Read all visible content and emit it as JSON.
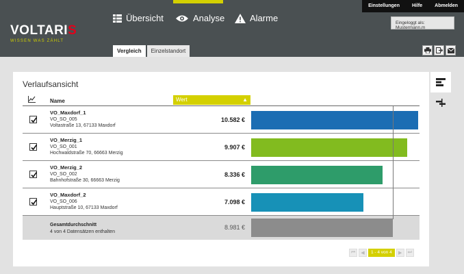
{
  "brand": {
    "name_main": "VOLTARI",
    "name_accent": "S",
    "tagline": "WISSEN WAS ZÄHLT"
  },
  "nav": [
    {
      "label": "Übersicht",
      "icon": "list-icon"
    },
    {
      "label": "Analyse",
      "icon": "eye-icon"
    },
    {
      "label": "Alarme",
      "icon": "warning-icon"
    }
  ],
  "top_links": [
    "Einstellungen",
    "Hilfe",
    "Abmelden"
  ],
  "logged_in": "Eingeloggt als: Mustermann.m",
  "subtabs": [
    {
      "label": "Vergleich",
      "active": true
    },
    {
      "label": "Einzelstandort",
      "active": false
    }
  ],
  "header_actions": [
    "print-icon",
    "export-icon",
    "mail-icon"
  ],
  "panel": {
    "title": "Verlaufsansicht",
    "columns": {
      "name": "Name",
      "value": "Wert"
    }
  },
  "side_tools": [
    "bar-view-icon",
    "split-view-icon"
  ],
  "rows": [
    {
      "name": "VO_Maxdorf_1",
      "code": "VO_SO_005",
      "address": "Voltastraße 13, 67133 Maxdorf",
      "value_label": "10.582 €",
      "value": 10582,
      "color": "#1b6db3",
      "checked": true
    },
    {
      "name": "VO_Merzig_1",
      "code": "VO_SO_001",
      "address": "Hochwaldstraße 70, 66663 Merzig",
      "value_label": "9.907 €",
      "value": 9907,
      "color": "#82bb1f",
      "checked": true
    },
    {
      "name": "VO_Merzig_2",
      "code": "VO_SO_002",
      "address": "Bahnhofstraße 30, 66663 Merzig",
      "value_label": "8.336 €",
      "value": 8336,
      "color": "#2e9c6a",
      "checked": true
    },
    {
      "name": "VO_Maxdorf_2",
      "code": "VO_SO_006",
      "address": "Hauptstraße 10, 67133 Maxdorf",
      "value_label": "7.098 €",
      "value": 7098,
      "color": "#1791b7",
      "checked": true
    }
  ],
  "total": {
    "name": "Gesamtdurchschnitt",
    "subtitle": "4 von 4 Datensätzen enthalten",
    "value_label": "8.981 €",
    "value": 8981,
    "color": "#8c8c8c"
  },
  "pager": {
    "info": "1 - 4 von 4"
  }
}
